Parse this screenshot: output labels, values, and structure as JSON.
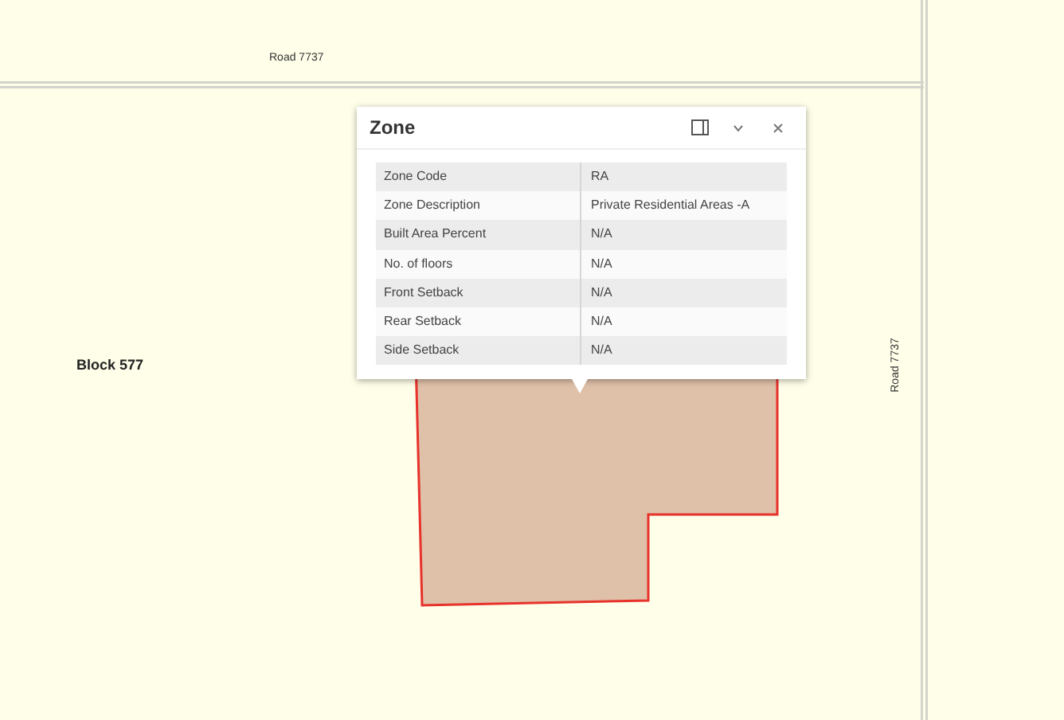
{
  "map": {
    "labels": [
      {
        "text": "Road 7737",
        "kind": "road"
      },
      {
        "text": "Block 577",
        "kind": "block"
      },
      {
        "text": "Road 7737",
        "kind": "road-vertical"
      }
    ]
  },
  "popup": {
    "title": "Zone",
    "rows": [
      {
        "label": "Zone Code",
        "value": "RA"
      },
      {
        "label": "Zone Description",
        "value": "Private Residential Areas -A"
      },
      {
        "label": "Built Area Percent",
        "value": "N/A"
      },
      {
        "label": "No. of floors",
        "value": "N/A"
      },
      {
        "label": "Front Setback",
        "value": "N/A"
      },
      {
        "label": "Rear Setback",
        "value": "N/A"
      },
      {
        "label": "Side Setback",
        "value": "N/A"
      }
    ]
  }
}
